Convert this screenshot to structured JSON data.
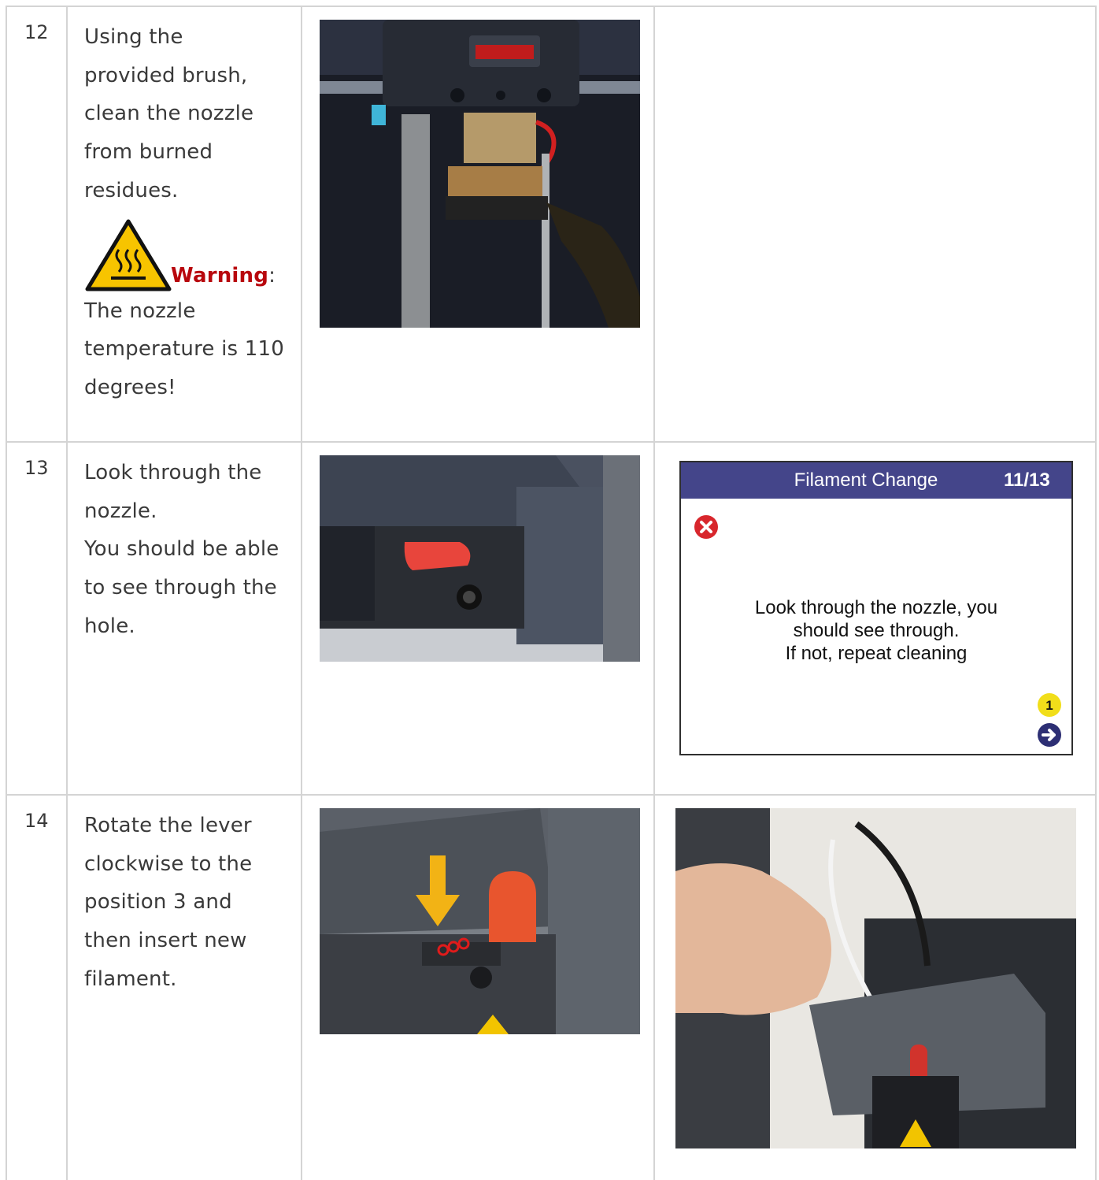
{
  "rows": [
    {
      "number": "12",
      "lines": [
        "Using the",
        "provided brush,",
        "clean the nozzle",
        "from burned",
        "residues."
      ],
      "warning_label": "Warning",
      "warning_colon": ":",
      "warning_lines": [
        "The nozzle",
        "temperature is 110",
        "degrees!"
      ],
      "photo": "nozzle cleaning with brass brush"
    },
    {
      "number": "13",
      "lines": [
        "Look through the",
        "nozzle.",
        "You should be able",
        "to see through the",
        "hole."
      ],
      "photo": "extruder underside with nozzle hole",
      "screen": {
        "title": "Filament Change",
        "page": "11/13",
        "message_lines": [
          "Look through the nozzle, you",
          "should see through.",
          "If not, repeat cleaning"
        ],
        "badge": "1",
        "icons": [
          "error-x-icon",
          "next-arrow-icon"
        ],
        "header_color": "#44458a"
      }
    },
    {
      "number": "14",
      "lines": [
        "Rotate the lever",
        "clockwise to the",
        "position 3 and",
        "then insert new",
        "filament."
      ],
      "photo": "lever at position 3 with arrow",
      "photo2": "hand inserting filament"
    }
  ],
  "colors": {
    "warning": "#b8070d",
    "lever": "#e8453c",
    "arrow": "#f2b315"
  }
}
